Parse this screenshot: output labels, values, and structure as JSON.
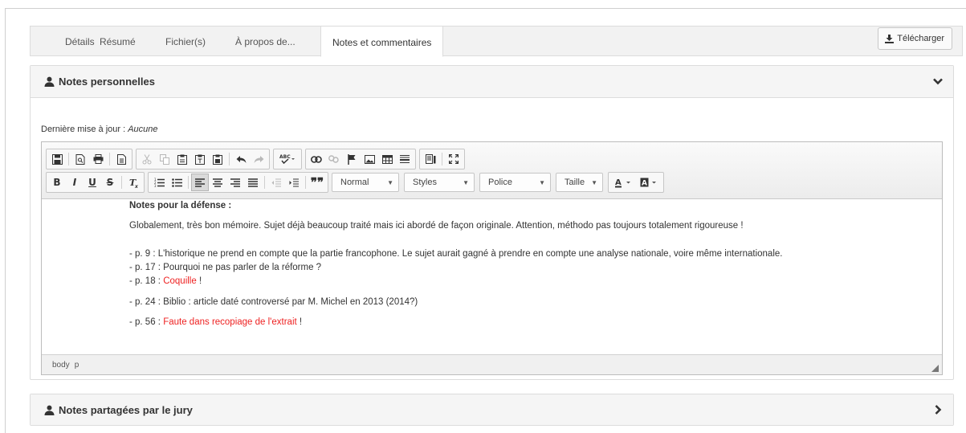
{
  "tabs": [
    {
      "label": "Détails"
    },
    {
      "label": "Résumé"
    },
    {
      "label": "Fichier(s)"
    },
    {
      "label": "À propos de..."
    },
    {
      "label": "Notes et commentaires",
      "active": true
    }
  ],
  "download_label": "Télécharger",
  "panel_personal": {
    "title": "Notes personnelles",
    "meta_label": "Dernière mise à jour :",
    "meta_value": "Aucune"
  },
  "editor": {
    "format_combo": "Normal",
    "styles_combo": "Styles",
    "font_combo": "Police",
    "size_combo": "Taille",
    "path": [
      "body",
      "p"
    ],
    "content": {
      "heading": "Notes pour la défense :",
      "summary": "Globalement, très bon mémoire. Sujet déjà beaucoup traité mais ici abordé de façon originale. Attention, méthodo pas toujours totalement rigoureuse !",
      "line1": "- p. 9 : L'historique ne prend en compte que la partie francophone. Le sujet aurait gagné à prendre en compte une analyse nationale, voire même internationale.",
      "line2": "- p. 17 : Pourquoi ne pas parler de la réforme ?",
      "line3_prefix": "- p. 18 :",
      "line3_red": "Coquille",
      "line3_suffix": "!",
      "line4": "- p. 24 : Biblio : article daté controversé par M. Michel en 2013 (2014?)",
      "line5_prefix": "- p. 56 :",
      "line5_red": "Faute dans recopiage de l'extrait",
      "line5_suffix": "!"
    }
  },
  "panel_shared": {
    "title": "Notes partagées par le jury"
  },
  "colors": {
    "error_text": "#ee2222",
    "panel_header": "#f5f5f5",
    "border": "#dcdcdc"
  }
}
